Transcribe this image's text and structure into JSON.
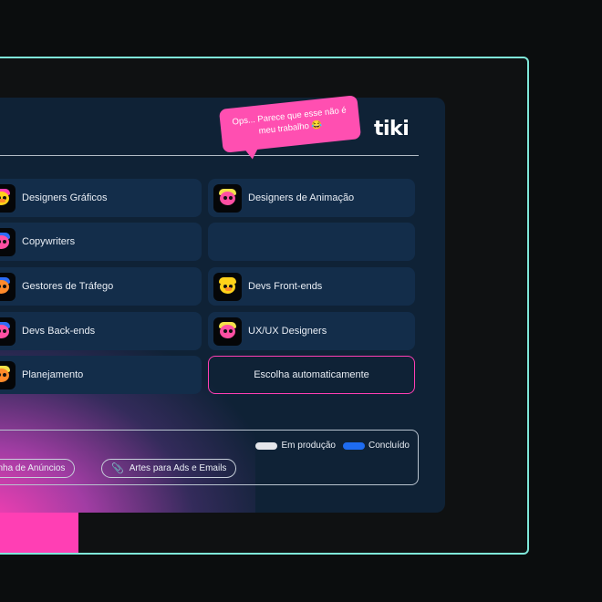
{
  "brand": {
    "logo": "tiki"
  },
  "roles": [
    {
      "label": "Designers Gráficos",
      "avatar": "yellow-duck-avatar",
      "face": "#ffd21a",
      "hair": "#ff3fb4"
    },
    {
      "label": "Designers de Animação",
      "avatar": "pink-face-avatar",
      "face": "#ff4fa3",
      "hair": "#f2e14a"
    },
    {
      "label": "Copywriters",
      "avatar": "pink-face-blue-hair-avatar",
      "face": "#ff4fa3",
      "hair": "#2d6cf5"
    },
    {
      "label": "Gestores de Tráfego",
      "avatar": "orange-face-blue-hair-avatar",
      "face": "#ff8a2a",
      "hair": "#2d6cf5"
    },
    {
      "label": "Devs Front-ends",
      "avatar": "yellow-duck-avatar",
      "face": "#ffd21a",
      "hair": "#ffd21a"
    },
    {
      "label": "Devs Back-ends",
      "avatar": "pink-face-blue-hair-avatar",
      "face": "#ff4fa3",
      "hair": "#2d6cf5"
    },
    {
      "label": "UX/UX Designers",
      "avatar": "pink-face-yellow-hair-avatar",
      "face": "#ff4fa3",
      "hair": "#f2e14a"
    },
    {
      "label": "Planejamento",
      "avatar": "orange-face-yellow-hair-avatar",
      "face": "#ff8a2a",
      "hair": "#f2e14a"
    }
  ],
  "auto_choice": {
    "label": "Escolha automaticamente"
  },
  "tooltip": {
    "text": "Ops... Parece que esse não é meu trabalho 😂"
  },
  "legend": [
    {
      "label": "Em produção",
      "color": "#e4e6ea"
    },
    {
      "label": "Concluído",
      "color": "#1e6cf0"
    }
  ],
  "chips": [
    {
      "label": "mpanha de Anúncios"
    },
    {
      "label": "Artes para Ads e Emails",
      "icon": "paperclip-icon"
    }
  ],
  "colors": {
    "accent": "#ff3fb4",
    "panel": "#0f2236",
    "card": "#132d4a",
    "frame": "#7fe7d9"
  }
}
